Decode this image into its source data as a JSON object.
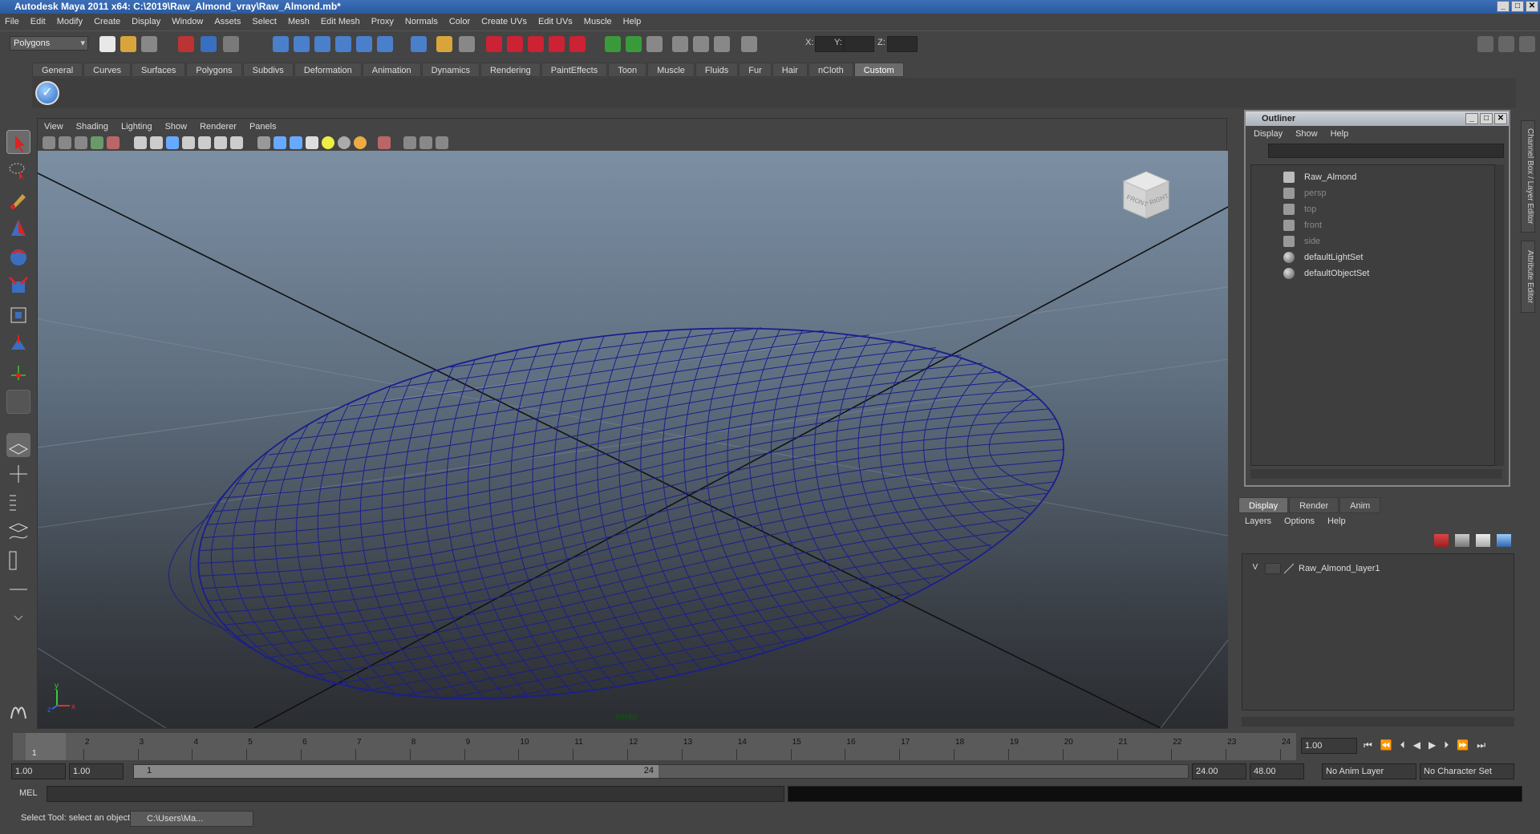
{
  "window": {
    "title": "Autodesk Maya 2011 x64: C:\\2019\\Raw_Almond_vray\\Raw_Almond.mb*"
  },
  "menubar": [
    "File",
    "Edit",
    "Modify",
    "Create",
    "Display",
    "Window",
    "Assets",
    "Select",
    "Mesh",
    "Edit Mesh",
    "Proxy",
    "Normals",
    "Color",
    "Create UVs",
    "Edit UVs",
    "Muscle",
    "Help"
  ],
  "statusline": {
    "mode": "Polygons",
    "x_label": "X:",
    "y_label": "Y:",
    "z_label": "Z:"
  },
  "shelf": {
    "tabs": [
      "General",
      "Curves",
      "Surfaces",
      "Polygons",
      "Subdivs",
      "Deformation",
      "Animation",
      "Dynamics",
      "Rendering",
      "PaintEffects",
      "Toon",
      "Muscle",
      "Fluids",
      "Fur",
      "Hair",
      "nCloth",
      "Custom"
    ],
    "active": "Custom"
  },
  "viewport": {
    "menu": [
      "View",
      "Shading",
      "Lighting",
      "Show",
      "Renderer",
      "Panels"
    ],
    "camera": "persp",
    "cube_front": "FRONT",
    "cube_right": "RIGHT",
    "axis_y": "y",
    "axis_x": "x",
    "axis_z": "z"
  },
  "outliner": {
    "title": "Outliner",
    "menu": [
      "Display",
      "Show",
      "Help"
    ],
    "items": [
      {
        "label": "Raw_Almond",
        "dim": false
      },
      {
        "label": "persp",
        "dim": true
      },
      {
        "label": "top",
        "dim": true
      },
      {
        "label": "front",
        "dim": true
      },
      {
        "label": "side",
        "dim": true
      },
      {
        "label": "defaultLightSet",
        "dim": false
      },
      {
        "label": "defaultObjectSet",
        "dim": false
      }
    ]
  },
  "side_tabs": {
    "channel": "Channel Box / Layer Editor",
    "attribute": "Attribute Editor"
  },
  "layers": {
    "tabs": [
      "Display",
      "Render",
      "Anim"
    ],
    "active": "Display",
    "menu": [
      "Layers",
      "Options",
      "Help"
    ],
    "row": {
      "visibility": "V",
      "name": "Raw_Almond_layer1"
    }
  },
  "timeslider": {
    "ticks": [
      "1",
      "2",
      "3",
      "4",
      "5",
      "6",
      "7",
      "8",
      "9",
      "10",
      "11",
      "12",
      "13",
      "14",
      "15",
      "16",
      "17",
      "18",
      "19",
      "20",
      "21",
      "22",
      "23",
      "24"
    ],
    "current_frame_marker": "1",
    "current_frame": "1.00"
  },
  "rangeslider": {
    "start": "1.00",
    "playback_start": "1.00",
    "range_start": "1",
    "range_end": "24",
    "playback_end": "24.00",
    "end": "48.00",
    "anim_layer": "No Anim Layer",
    "character_set": "No Character Set"
  },
  "cmdline": {
    "label": "MEL"
  },
  "helpline": {
    "text": "Select Tool: select an object",
    "task": "C:\\Users\\Ma..."
  },
  "colors": {
    "wireframe": "#1a1f8c",
    "accent": "#2a5aa0"
  }
}
